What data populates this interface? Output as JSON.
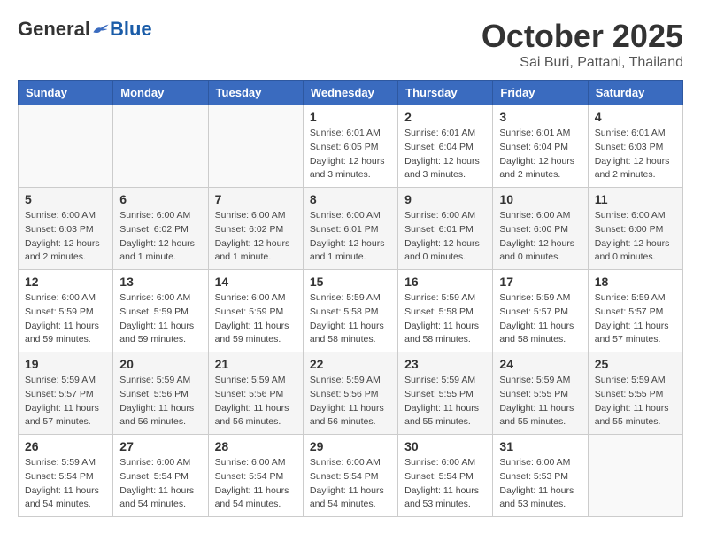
{
  "header": {
    "logo_general": "General",
    "logo_blue": "Blue",
    "month_title": "October 2025",
    "subtitle": "Sai Buri, Pattani, Thailand"
  },
  "days_of_week": [
    "Sunday",
    "Monday",
    "Tuesday",
    "Wednesday",
    "Thursday",
    "Friday",
    "Saturday"
  ],
  "weeks": [
    [
      {
        "day": "",
        "info": ""
      },
      {
        "day": "",
        "info": ""
      },
      {
        "day": "",
        "info": ""
      },
      {
        "day": "1",
        "info": "Sunrise: 6:01 AM\nSunset: 6:05 PM\nDaylight: 12 hours\nand 3 minutes."
      },
      {
        "day": "2",
        "info": "Sunrise: 6:01 AM\nSunset: 6:04 PM\nDaylight: 12 hours\nand 3 minutes."
      },
      {
        "day": "3",
        "info": "Sunrise: 6:01 AM\nSunset: 6:04 PM\nDaylight: 12 hours\nand 2 minutes."
      },
      {
        "day": "4",
        "info": "Sunrise: 6:01 AM\nSunset: 6:03 PM\nDaylight: 12 hours\nand 2 minutes."
      }
    ],
    [
      {
        "day": "5",
        "info": "Sunrise: 6:00 AM\nSunset: 6:03 PM\nDaylight: 12 hours\nand 2 minutes."
      },
      {
        "day": "6",
        "info": "Sunrise: 6:00 AM\nSunset: 6:02 PM\nDaylight: 12 hours\nand 1 minute."
      },
      {
        "day": "7",
        "info": "Sunrise: 6:00 AM\nSunset: 6:02 PM\nDaylight: 12 hours\nand 1 minute."
      },
      {
        "day": "8",
        "info": "Sunrise: 6:00 AM\nSunset: 6:01 PM\nDaylight: 12 hours\nand 1 minute."
      },
      {
        "day": "9",
        "info": "Sunrise: 6:00 AM\nSunset: 6:01 PM\nDaylight: 12 hours\nand 0 minutes."
      },
      {
        "day": "10",
        "info": "Sunrise: 6:00 AM\nSunset: 6:00 PM\nDaylight: 12 hours\nand 0 minutes."
      },
      {
        "day": "11",
        "info": "Sunrise: 6:00 AM\nSunset: 6:00 PM\nDaylight: 12 hours\nand 0 minutes."
      }
    ],
    [
      {
        "day": "12",
        "info": "Sunrise: 6:00 AM\nSunset: 5:59 PM\nDaylight: 11 hours\nand 59 minutes."
      },
      {
        "day": "13",
        "info": "Sunrise: 6:00 AM\nSunset: 5:59 PM\nDaylight: 11 hours\nand 59 minutes."
      },
      {
        "day": "14",
        "info": "Sunrise: 6:00 AM\nSunset: 5:59 PM\nDaylight: 11 hours\nand 59 minutes."
      },
      {
        "day": "15",
        "info": "Sunrise: 5:59 AM\nSunset: 5:58 PM\nDaylight: 11 hours\nand 58 minutes."
      },
      {
        "day": "16",
        "info": "Sunrise: 5:59 AM\nSunset: 5:58 PM\nDaylight: 11 hours\nand 58 minutes."
      },
      {
        "day": "17",
        "info": "Sunrise: 5:59 AM\nSunset: 5:57 PM\nDaylight: 11 hours\nand 58 minutes."
      },
      {
        "day": "18",
        "info": "Sunrise: 5:59 AM\nSunset: 5:57 PM\nDaylight: 11 hours\nand 57 minutes."
      }
    ],
    [
      {
        "day": "19",
        "info": "Sunrise: 5:59 AM\nSunset: 5:57 PM\nDaylight: 11 hours\nand 57 minutes."
      },
      {
        "day": "20",
        "info": "Sunrise: 5:59 AM\nSunset: 5:56 PM\nDaylight: 11 hours\nand 56 minutes."
      },
      {
        "day": "21",
        "info": "Sunrise: 5:59 AM\nSunset: 5:56 PM\nDaylight: 11 hours\nand 56 minutes."
      },
      {
        "day": "22",
        "info": "Sunrise: 5:59 AM\nSunset: 5:56 PM\nDaylight: 11 hours\nand 56 minutes."
      },
      {
        "day": "23",
        "info": "Sunrise: 5:59 AM\nSunset: 5:55 PM\nDaylight: 11 hours\nand 55 minutes."
      },
      {
        "day": "24",
        "info": "Sunrise: 5:59 AM\nSunset: 5:55 PM\nDaylight: 11 hours\nand 55 minutes."
      },
      {
        "day": "25",
        "info": "Sunrise: 5:59 AM\nSunset: 5:55 PM\nDaylight: 11 hours\nand 55 minutes."
      }
    ],
    [
      {
        "day": "26",
        "info": "Sunrise: 5:59 AM\nSunset: 5:54 PM\nDaylight: 11 hours\nand 54 minutes."
      },
      {
        "day": "27",
        "info": "Sunrise: 6:00 AM\nSunset: 5:54 PM\nDaylight: 11 hours\nand 54 minutes."
      },
      {
        "day": "28",
        "info": "Sunrise: 6:00 AM\nSunset: 5:54 PM\nDaylight: 11 hours\nand 54 minutes."
      },
      {
        "day": "29",
        "info": "Sunrise: 6:00 AM\nSunset: 5:54 PM\nDaylight: 11 hours\nand 54 minutes."
      },
      {
        "day": "30",
        "info": "Sunrise: 6:00 AM\nSunset: 5:54 PM\nDaylight: 11 hours\nand 53 minutes."
      },
      {
        "day": "31",
        "info": "Sunrise: 6:00 AM\nSunset: 5:53 PM\nDaylight: 11 hours\nand 53 minutes."
      },
      {
        "day": "",
        "info": ""
      }
    ]
  ]
}
